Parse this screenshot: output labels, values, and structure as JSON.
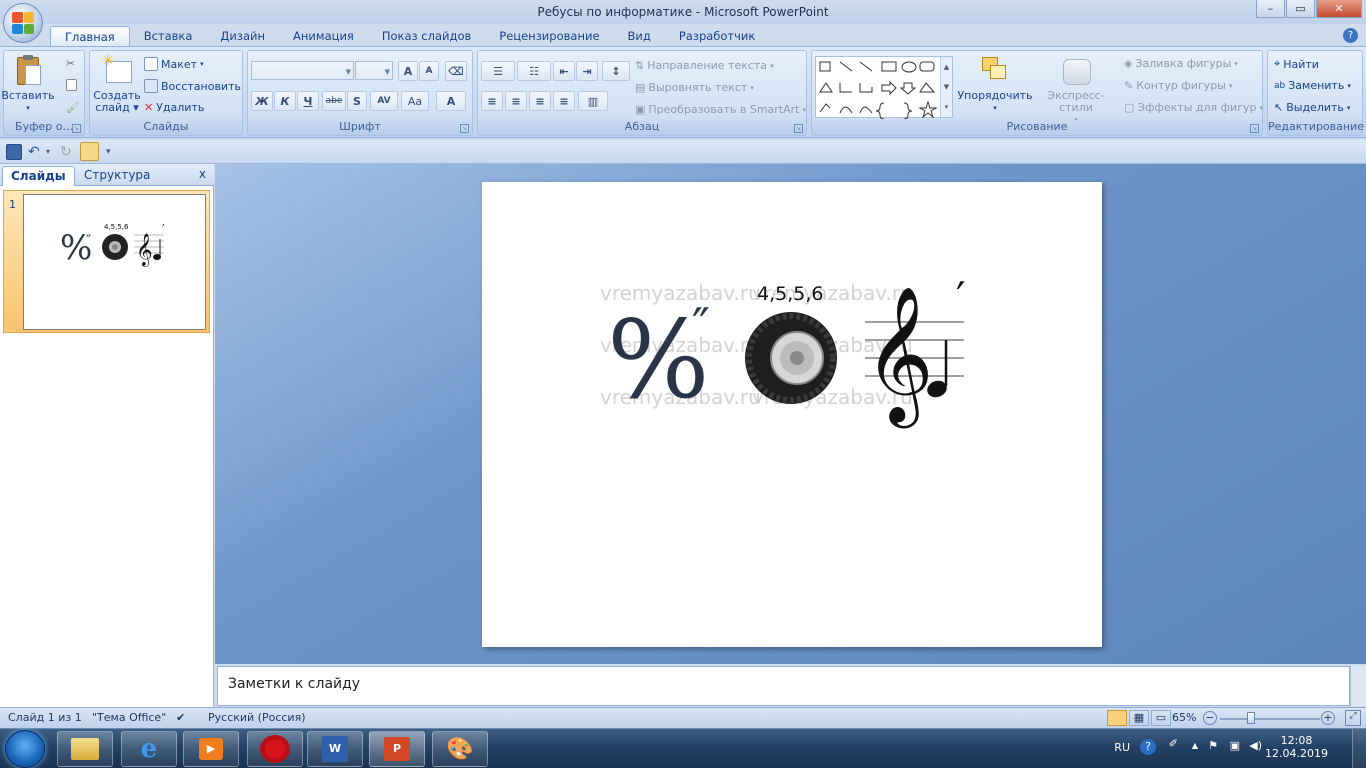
{
  "window": {
    "title": "Ребусы по информатике - Microsoft PowerPoint",
    "minimize": "–",
    "maximize": "▭",
    "close": "✕"
  },
  "ribbon_tabs": [
    "Главная",
    "Вставка",
    "Дизайн",
    "Анимация",
    "Показ слайдов",
    "Рецензирование",
    "Вид",
    "Разработчик"
  ],
  "groups": {
    "clipboard": {
      "label": "Буфер о...",
      "paste": "Вставить"
    },
    "slides": {
      "label": "Слайды",
      "new_slide_line1": "Создать",
      "new_slide_line2": "слайд",
      "layout": "Макет",
      "reset": "Восстановить",
      "delete": "Удалить"
    },
    "font": {
      "label": "Шрифт",
      "bold": "Ж",
      "italic": "К",
      "underline": "Ч",
      "strike": "abe",
      "shadow": "S",
      "spacing": "AV",
      "case": "Aa",
      "grow": "A",
      "shrink": "A",
      "color": "A"
    },
    "paragraph": {
      "label": "Абзац",
      "text_direction": "Направление текста",
      "align_text": "Выровнять текст",
      "smartart": "Преобразовать в SmartArt"
    },
    "drawing": {
      "label": "Рисование",
      "arrange": "Упорядочить",
      "quick_styles": "Экспресс-стили",
      "fill": "Заливка фигуры",
      "outline": "Контур фигуры",
      "effects": "Эффекты для фигур"
    },
    "editing": {
      "label": "Редактирование",
      "find": "Найти",
      "replace": "Заменить",
      "select": "Выделить"
    }
  },
  "pane": {
    "tab_slides": "Слайды",
    "tab_outline": "Структура",
    "close": "x",
    "slide_number": "1"
  },
  "slide": {
    "rebus_numbers": "4,5,5,6",
    "percent_sign": "%",
    "quote_mark": "″",
    "prime_mark": "′",
    "watermark": "vremyazabav.ru"
  },
  "notes": {
    "placeholder": "Заметки к слайду"
  },
  "status": {
    "slide_info": "Слайд 1 из 1",
    "theme": "\"Тема Office\"",
    "language": "Русский (Россия)",
    "zoom": "65%",
    "zoom_value": 65
  },
  "taskbar": {
    "lang": "RU",
    "time": "12:08",
    "date": "12.04.2019"
  },
  "colors": {
    "ribbon_bg": "#c5d8f1",
    "workspace": "#6d95c9",
    "title_text": "#15428b",
    "selected_thumb": "#f8c36c"
  }
}
